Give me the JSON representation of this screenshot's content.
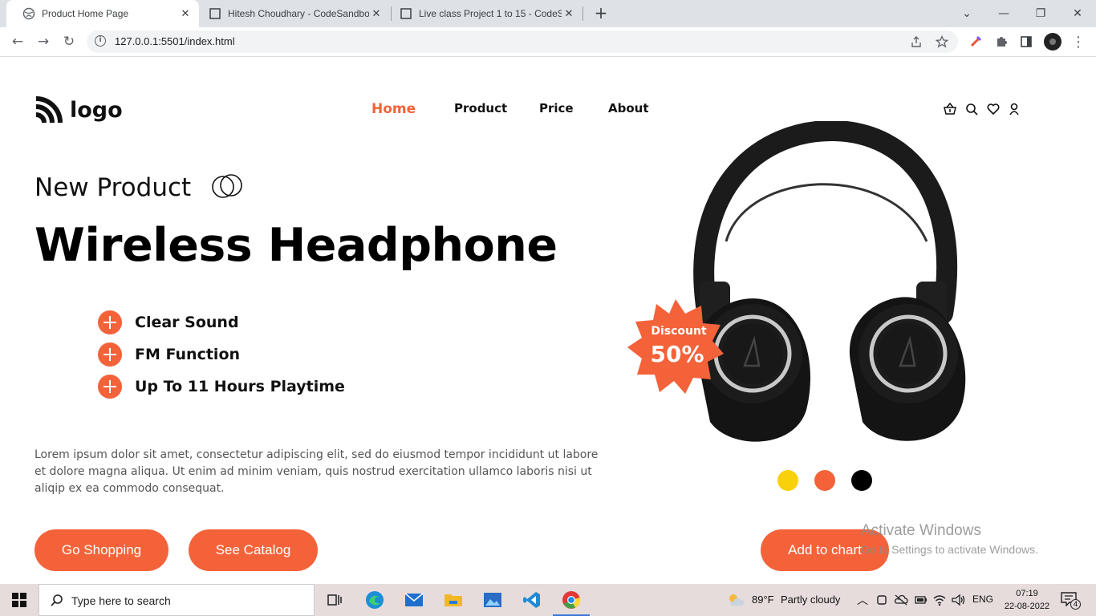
{
  "browser": {
    "tabs": [
      {
        "title": "Product Home Page",
        "active": true
      },
      {
        "title": "Hitesh Choudhary - CodeSandbox",
        "active": false
      },
      {
        "title": "Live class Project 1 to 15 - CodeS",
        "active": false
      }
    ],
    "url": "127.0.0.1:5501/index.html"
  },
  "header": {
    "logo_text": "logo",
    "nav": [
      "Home",
      "Product",
      "Price",
      "About"
    ],
    "icons": [
      "basket-icon",
      "search-icon",
      "heart-icon",
      "user-icon"
    ]
  },
  "hero": {
    "tagline": "New Product",
    "title": "Wireless Headphone",
    "features": [
      "Clear Sound",
      "FM Function",
      "Up To 11 Hours Playtime"
    ],
    "description": "Lorem ipsum dolor sit amet, consectetur adipiscing elit, sed do eiusmod tempor incididunt ut labore et dolore magna aliqua. Ut enim ad minim veniam, quis nostrud exercitation ullamco laboris nisi ut aliqip ex ea commodo consequat.",
    "buttons": {
      "shop": "Go Shopping",
      "catalog": "See Catalog",
      "cart": "Add to chart"
    },
    "badge": {
      "label": "Discount",
      "value": "50%"
    },
    "swatches": [
      "#f9d10a",
      "#f4623a",
      "#000000"
    ]
  },
  "watermark": {
    "line1": "Activate Windows",
    "line2": "Go to Settings to activate Windows."
  },
  "taskbar": {
    "search_placeholder": "Type here to search",
    "weather_temp": "89°F",
    "weather_desc": "Partly cloudy",
    "lang": "ENG",
    "time": "07:19",
    "date": "22-08-2022",
    "notifications": "4"
  },
  "colors": {
    "accent": "#f4623a"
  }
}
